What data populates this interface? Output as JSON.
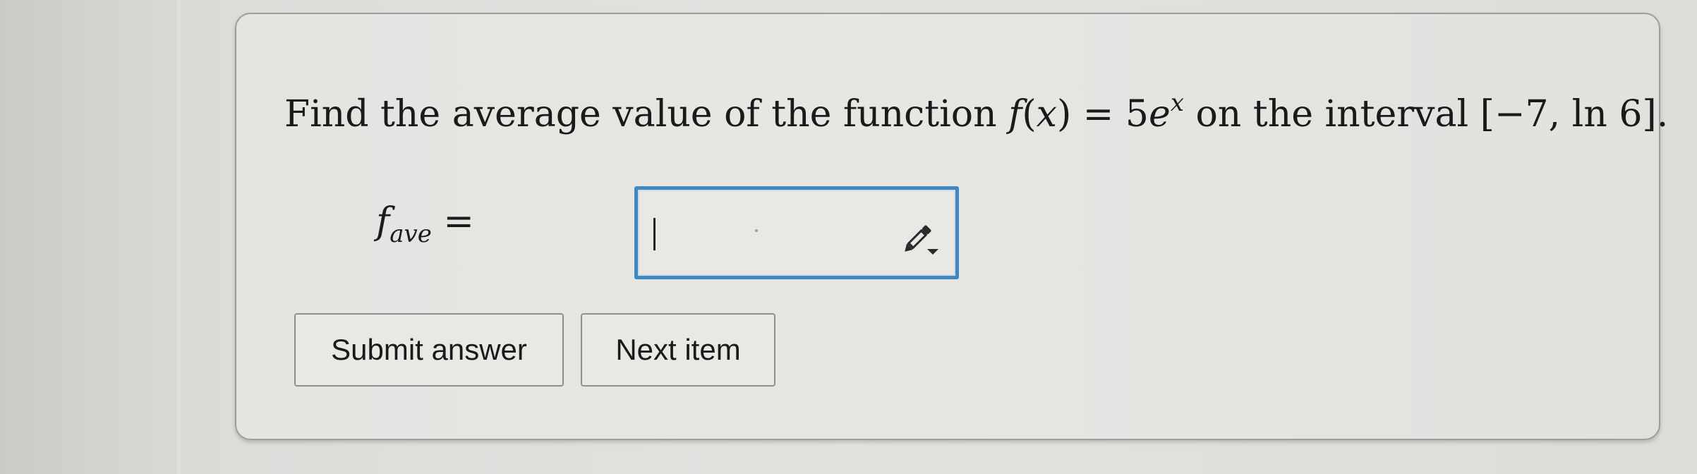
{
  "question": {
    "prefix": "Find the average value of the function ",
    "func_name": "f",
    "func_arg_open": "(",
    "func_var": "x",
    "func_arg_close": ")",
    "equals": " = 5",
    "base": "e",
    "exponent": "x",
    "middle": " on the interval [−7, ln 6]."
  },
  "answer": {
    "label_f": "f",
    "label_sub": "ave",
    "label_eq": " =",
    "value": ""
  },
  "icons": {
    "editor": "pencil-dropdown-icon"
  },
  "buttons": {
    "submit_label": "Submit answer",
    "next_label": "Next item"
  },
  "colors": {
    "input_border": "#3f88c3",
    "card_border": "#9d9e9b",
    "background": "#e2e2df"
  }
}
